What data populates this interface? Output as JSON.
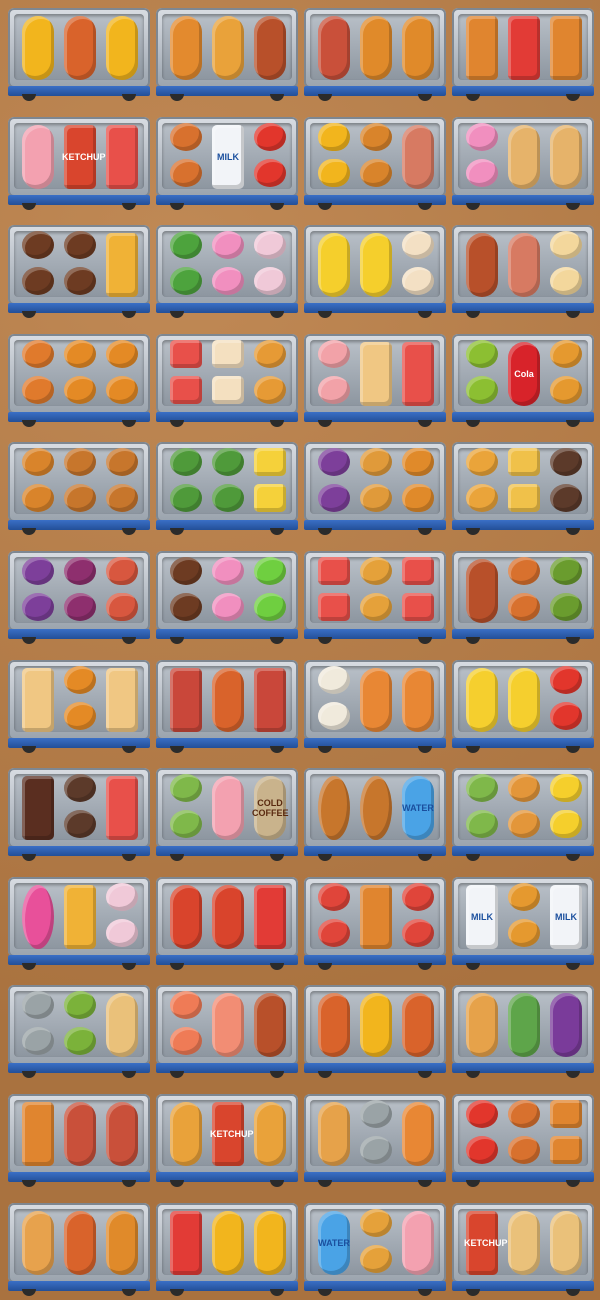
{
  "colors": {
    "background": "#b07a4b",
    "tray_base": "#2f60b4"
  },
  "trays": [
    {
      "slots": [
        [
          "fries"
        ],
        [
          "hotdog"
        ],
        [
          "fries"
        ]
      ]
    },
    {
      "slots": [
        [
          "sandwich-bun"
        ],
        [
          "taco"
        ],
        [
          "sausage"
        ]
      ]
    },
    {
      "slots": [
        [
          "steak"
        ],
        [
          "chicken-wing"
        ],
        [
          "chicken-wing"
        ]
      ]
    },
    {
      "slots": [
        [
          "bread-loaf"
        ],
        [
          "soda-cup"
        ],
        [
          "bread-loaf"
        ]
      ]
    },
    {
      "slots": [
        [
          "popsicle"
        ],
        [
          "ketchup-packets"
        ],
        [
          "juice-cup"
        ]
      ]
    },
    {
      "slots": [
        [
          "pie",
          "pie"
        ],
        [
          "milk-carton"
        ],
        [
          "tomato",
          "tomato"
        ]
      ]
    },
    {
      "slots": [
        [
          "fries",
          "fries"
        ],
        [
          "chicken-drumstick",
          "chicken-drumstick"
        ],
        [
          "ham-leg"
        ]
      ]
    },
    {
      "slots": [
        [
          "donut",
          "donut"
        ],
        [
          "wafer-roll"
        ],
        [
          "wafer-roll"
        ]
      ]
    },
    {
      "slots": [
        [
          "blueberry-cake",
          "blueberry-cake"
        ],
        [
          "blueberry-cake",
          "blueberry-cake"
        ],
        [
          "pizza-slice"
        ]
      ]
    },
    {
      "slots": [
        [
          "salad",
          "salad"
        ],
        [
          "donut",
          "donut"
        ],
        [
          "ice-cream-sundae",
          "ice-cream-sundae"
        ]
      ]
    },
    {
      "slots": [
        [
          "corn"
        ],
        [
          "corn"
        ],
        [
          "cupcake",
          "cupcake"
        ]
      ]
    },
    {
      "slots": [
        [
          "sausage"
        ],
        [
          "ham-leg"
        ],
        [
          "popcorn",
          "popcorn"
        ]
      ]
    },
    {
      "slots": [
        [
          "sushi-roll",
          "sushi-roll"
        ],
        [
          "pretzel-bowl",
          "pretzel-bowl"
        ],
        [
          "pretzel-bowl",
          "pretzel-bowl"
        ]
      ]
    },
    {
      "slots": [
        [
          "juice-cup",
          "juice-cup"
        ],
        [
          "strawberry-cake",
          "strawberry-cake"
        ],
        [
          "tart",
          "tart"
        ]
      ]
    },
    {
      "slots": [
        [
          "ham",
          "ham"
        ],
        [
          "toast-sandwich"
        ],
        [
          "juice-cup"
        ]
      ]
    },
    {
      "slots": [
        [
          "kiwi",
          "kiwi"
        ],
        [
          "cola-can"
        ],
        [
          "waffle",
          "waffle"
        ]
      ]
    },
    {
      "slots": [
        [
          "chicken-drumstick",
          "chicken-drumstick"
        ],
        [
          "burger",
          "burger"
        ],
        [
          "burger",
          "burger"
        ]
      ]
    },
    {
      "slots": [
        [
          "broccoli",
          "broccoli"
        ],
        [
          "broccoli",
          "broccoli"
        ],
        [
          "cheese",
          "cheese"
        ]
      ]
    },
    {
      "slots": [
        [
          "grapes",
          "grapes"
        ],
        [
          "onion-rings",
          "onion-rings"
        ],
        [
          "chicken-wing",
          "chicken-wing"
        ]
      ]
    },
    {
      "slots": [
        [
          "egg-tart",
          "egg-tart"
        ],
        [
          "toast",
          "toast"
        ],
        [
          "cookie",
          "cookie"
        ]
      ]
    },
    {
      "slots": [
        [
          "grapes",
          "grapes"
        ],
        [
          "onion",
          "onion"
        ],
        [
          "octopus",
          "octopus"
        ]
      ]
    },
    {
      "slots": [
        [
          "blueberry-cake",
          "blueberry-cake"
        ],
        [
          "donut",
          "donut"
        ],
        [
          "jelly",
          "jelly"
        ]
      ]
    },
    {
      "slots": [
        [
          "juice-cup",
          "juice-cup"
        ],
        [
          "pasta",
          "pasta"
        ],
        [
          "juice-cup",
          "juice-cup"
        ]
      ]
    },
    {
      "slots": [
        [
          "sausage"
        ],
        [
          "pie",
          "pie"
        ],
        [
          "avocado",
          "avocado"
        ]
      ]
    },
    {
      "slots": [
        [
          "toast-sandwich"
        ],
        [
          "pretzel-bowl",
          "pretzel-bowl"
        ],
        [
          "toast-sandwich"
        ]
      ]
    },
    {
      "slots": [
        [
          "bacon"
        ],
        [
          "hotdog"
        ],
        [
          "bacon"
        ]
      ]
    },
    {
      "slots": [
        [
          "mushroom",
          "mushroom"
        ],
        [
          "squid"
        ],
        [
          "squid"
        ]
      ]
    },
    {
      "slots": [
        [
          "banana"
        ],
        [
          "banana"
        ],
        [
          "tomato",
          "tomato"
        ]
      ]
    },
    {
      "slots": [
        [
          "chocolate-bar"
        ],
        [
          "cookie",
          "cookie"
        ],
        [
          "juice-cup"
        ]
      ]
    },
    {
      "slots": [
        [
          "swiss-roll",
          "swiss-roll"
        ],
        [
          "popsicle"
        ],
        [
          "coffee-can"
        ]
      ]
    },
    {
      "slots": [
        [
          "burger"
        ],
        [
          "burger"
        ],
        [
          "water-bottle"
        ]
      ]
    },
    {
      "slots": [
        [
          "swiss-roll",
          "swiss-roll"
        ],
        [
          "croissant",
          "croissant"
        ],
        [
          "corn",
          "corn"
        ]
      ]
    },
    {
      "slots": [
        [
          "dragon-fruit"
        ],
        [
          "pizza-slice"
        ],
        [
          "ice-cream-sundae",
          "ice-cream-sundae"
        ]
      ]
    },
    {
      "slots": [
        [
          "lobster"
        ],
        [
          "lobster"
        ],
        [
          "soda-cup"
        ]
      ]
    },
    {
      "slots": [
        [
          "jam-toast",
          "jam-toast"
        ],
        [
          "bread-loaf"
        ],
        [
          "jam-toast",
          "jam-toast"
        ]
      ]
    },
    {
      "slots": [
        [
          "milk-carton"
        ],
        [
          "waffle",
          "waffle"
        ],
        [
          "milk-carton"
        ]
      ]
    },
    {
      "slots": [
        [
          "oyster",
          "oyster"
        ],
        [
          "kebab",
          "kebab"
        ],
        [
          "burrito"
        ]
      ]
    },
    {
      "slots": [
        [
          "shrimp",
          "shrimp"
        ],
        [
          "salmon-steak"
        ],
        [
          "sausage"
        ]
      ]
    },
    {
      "slots": [
        [
          "hotdog"
        ],
        [
          "fries"
        ],
        [
          "hotdog"
        ]
      ]
    },
    {
      "slots": [
        [
          "fish"
        ],
        [
          "asparagus"
        ],
        [
          "eggplant"
        ]
      ]
    },
    {
      "slots": [
        [
          "bread-loaf"
        ],
        [
          "steak"
        ],
        [
          "steak"
        ]
      ]
    },
    {
      "slots": [
        [
          "taco"
        ],
        [
          "ketchup-packets"
        ],
        [
          "taco"
        ]
      ]
    },
    {
      "slots": [
        [
          "fish"
        ],
        [
          "oyster",
          "oyster"
        ],
        [
          "squid"
        ]
      ]
    },
    {
      "slots": [
        [
          "tomato",
          "tomato"
        ],
        [
          "pie",
          "pie"
        ],
        [
          "bread-loaf",
          "bread-loaf"
        ]
      ]
    },
    {
      "slots": [
        [
          "baguette"
        ],
        [
          "hotdog"
        ],
        [
          "chicken-wing"
        ]
      ]
    },
    {
      "slots": [
        [
          "soda-cup"
        ],
        [
          "fries"
        ],
        [
          "fries"
        ]
      ]
    },
    {
      "slots": [
        [
          "water-bottle"
        ],
        [
          "pasta",
          "pasta"
        ],
        [
          "popsicle"
        ]
      ]
    },
    {
      "slots": [
        [
          "ketchup-packets"
        ],
        [
          "burrito"
        ],
        [
          "burrito"
        ]
      ]
    }
  ],
  "labels": {
    "milk": "MILK",
    "ketchup": "KETCHUP",
    "cola": "Cola",
    "water": "WATER",
    "coffee": "COLD COFFEE"
  }
}
